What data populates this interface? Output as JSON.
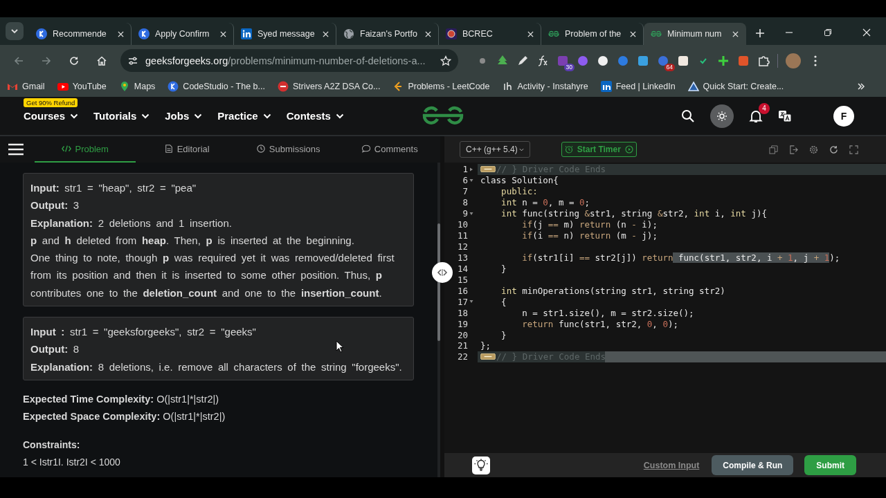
{
  "browser": {
    "tabs": [
      {
        "title": "Recommende",
        "kind": "k",
        "selected": false
      },
      {
        "title": "Apply Confirm",
        "kind": "k",
        "selected": false
      },
      {
        "title": "Syed message",
        "kind": "linkedin",
        "selected": false
      },
      {
        "title": "Faizan's Portfo",
        "kind": "globe",
        "selected": false
      },
      {
        "title": "BCREC",
        "kind": "crest",
        "selected": false
      },
      {
        "title": "Problem of the",
        "kind": "gfg",
        "selected": false
      },
      {
        "title": "Minimum num",
        "kind": "gfg",
        "selected": true
      }
    ],
    "url_host": "geeksforgeeks.org",
    "url_path": "/problems/minimum-number-of-deletions-a...",
    "extensions": [
      {
        "kind": "dot"
      },
      {
        "kind": "tree"
      },
      {
        "kind": "pen"
      },
      {
        "kind": "fx"
      },
      {
        "kind": "hat",
        "badge": "30"
      },
      {
        "kind": "gear"
      },
      {
        "kind": "ring"
      },
      {
        "kind": "swirl"
      },
      {
        "kind": "tile"
      },
      {
        "kind": "chrome",
        "badge": "64"
      },
      {
        "kind": "card"
      },
      {
        "kind": "tick"
      },
      {
        "kind": "plus"
      },
      {
        "kind": "orange"
      },
      {
        "kind": "puzzle"
      }
    ],
    "bookmarks": [
      {
        "label": "Gmail",
        "kind": "gmail"
      },
      {
        "label": "YouTube",
        "kind": "youtube"
      },
      {
        "label": "Maps",
        "kind": "maps"
      },
      {
        "label": "CodeStudio - The b...",
        "kind": "k"
      },
      {
        "label": "Strivers A2Z DSA Co...",
        "kind": "tuf"
      },
      {
        "label": "Problems - LeetCode",
        "kind": "leetcode"
      },
      {
        "label": "Activity - Instahyre",
        "kind": "ih"
      },
      {
        "label": "Feed | LinkedIn",
        "kind": "linkedin"
      },
      {
        "label": "Quick Start: Create...",
        "kind": "triangle"
      }
    ]
  },
  "site": {
    "promo": "Get 90% Refund",
    "nav": [
      "Courses",
      "Tutorials",
      "Jobs",
      "Practice",
      "Contests"
    ],
    "notifications": "4",
    "avatar": "F"
  },
  "problem_tabs": [
    {
      "label": "Problem",
      "kind": "code",
      "selected": true
    },
    {
      "label": "Editorial",
      "kind": "doc",
      "selected": false
    },
    {
      "label": "Submissions",
      "kind": "clock",
      "selected": false
    },
    {
      "label": "Comments",
      "kind": "chat",
      "selected": false
    }
  ],
  "examples": [
    [
      "**Input:** str1 = \"heap\", str2 = \"pea\"",
      "**Output:** 3",
      "**Explanation:** 2 deletions and 1 insertion.",
      "**p** and **h** deleted from **heap**. Then, **p** is inserted at the beginning.",
      "One thing to note, though **p** was required yet it was removed/deleted first from its position and then it is inserted to some other position. Thus, **p** contributes one to the **deletion_count** and one to the **insertion_count**."
    ],
    [
      "**Input :** str1 = \"geeksforgeeks\", str2 = \"geeks\"",
      "**Output:** 8",
      "**Explanation:** 8 deletions, i.e. remove all characters of the string \"forgeeks\"."
    ]
  ],
  "complexity": [
    "**Expected Time Complexity:** O(|str1|*|str2|)",
    "**Expected Space Complexity:** O(|str1|*|str2|)"
  ],
  "constraints_title": "Constraints:",
  "constraints": "1 < Istr1I. Istr2I < 1000",
  "editor": {
    "language": "C++ (g++ 5.4)",
    "timer": "Start Timer",
    "lines": [
      {
        "number": "1",
        "expanded": false,
        "folded": true,
        "active": false,
        "tokens": [
          {
            "text": "// } Driver Code Ends",
            "kind": "comment",
            "selected": false
          }
        ]
      },
      {
        "number": "6",
        "expanded": true,
        "folded": false,
        "active": false,
        "tokens": [
          {
            "text": "class Solution{",
            "kind": "plain",
            "selected": false
          }
        ]
      },
      {
        "number": "7",
        "folded": false,
        "active": false,
        "tokens": [
          {
            "text": "    public:",
            "kind": "type",
            "selected": false
          }
        ]
      },
      {
        "number": "8",
        "folded": false,
        "active": false,
        "tokens": [
          {
            "text": "    int",
            "kind": "type",
            "selected": false
          },
          {
            "text": " n = ",
            "kind": "plain",
            "selected": false
          },
          {
            "text": "0",
            "kind": "number",
            "selected": false
          },
          {
            "text": ", m = ",
            "kind": "plain",
            "selected": false
          },
          {
            "text": "0",
            "kind": "number",
            "selected": false
          },
          {
            "text": ";",
            "kind": "plain",
            "selected": false
          }
        ]
      },
      {
        "number": "9",
        "expanded": true,
        "folded": false,
        "active": false,
        "tokens": [
          {
            "text": "    int",
            "kind": "type",
            "selected": false
          },
          {
            "text": " func(string ",
            "kind": "plain",
            "selected": false
          },
          {
            "text": "&",
            "kind": "op",
            "selected": false
          },
          {
            "text": "str1, string ",
            "kind": "plain",
            "selected": false
          },
          {
            "text": "&",
            "kind": "op",
            "selected": false
          },
          {
            "text": "str2, ",
            "kind": "plain",
            "selected": false
          },
          {
            "text": "int",
            "kind": "type",
            "selected": false
          },
          {
            "text": " i, ",
            "kind": "plain",
            "selected": false
          },
          {
            "text": "int",
            "kind": "type",
            "selected": false
          },
          {
            "text": " j){",
            "kind": "plain",
            "selected": false
          }
        ]
      },
      {
        "number": "10",
        "folded": false,
        "active": false,
        "tokens": [
          {
            "text": "        if",
            "kind": "op",
            "selected": false
          },
          {
            "text": "(j ",
            "kind": "plain",
            "selected": false
          },
          {
            "text": "==",
            "kind": "op",
            "selected": false
          },
          {
            "text": " m) ",
            "kind": "plain",
            "selected": false
          },
          {
            "text": "return",
            "kind": "op",
            "selected": false
          },
          {
            "text": " (n ",
            "kind": "plain",
            "selected": false
          },
          {
            "text": "-",
            "kind": "op",
            "selected": false
          },
          {
            "text": " i);",
            "kind": "plain",
            "selected": false
          }
        ]
      },
      {
        "number": "11",
        "folded": false,
        "active": false,
        "tokens": [
          {
            "text": "        if",
            "kind": "op",
            "selected": false
          },
          {
            "text": "(i ",
            "kind": "plain",
            "selected": false
          },
          {
            "text": "==",
            "kind": "op",
            "selected": false
          },
          {
            "text": " n) ",
            "kind": "plain",
            "selected": false
          },
          {
            "text": "return",
            "kind": "op",
            "selected": false
          },
          {
            "text": " (m ",
            "kind": "plain",
            "selected": false
          },
          {
            "text": "-",
            "kind": "op",
            "selected": false
          },
          {
            "text": " j);",
            "kind": "plain",
            "selected": false
          }
        ]
      },
      {
        "number": "12",
        "folded": false,
        "active": false
      },
      {
        "number": "13",
        "folded": false,
        "active": false,
        "tokens": [
          {
            "text": "        if",
            "kind": "op",
            "selected": false
          },
          {
            "text": "(str1[i] ",
            "kind": "plain",
            "selected": false
          },
          {
            "text": "==",
            "kind": "op",
            "selected": false
          },
          {
            "text": " str2[j]) ",
            "kind": "plain",
            "selected": false
          },
          {
            "text": "return",
            "kind": "op",
            "selected": false
          },
          {
            "text": " func(str1, str2, i ",
            "kind": "plain",
            "selected": true
          },
          {
            "text": "+",
            "kind": "op",
            "selected": true
          },
          {
            "text": " 1",
            "kind": "number",
            "selected": true
          },
          {
            "text": ", j ",
            "kind": "plain",
            "selected": true
          },
          {
            "text": "+",
            "kind": "op",
            "selected": true
          },
          {
            "text": " 1",
            "kind": "number",
            "selected": true
          },
          {
            "text": ");",
            "kind": "plain",
            "selected": false
          }
        ]
      },
      {
        "number": "14",
        "folded": false,
        "active": false,
        "tokens": [
          {
            "text": "    }",
            "kind": "plain",
            "selected": false
          }
        ]
      },
      {
        "number": "15",
        "folded": false,
        "active": false
      },
      {
        "number": "16",
        "folded": false,
        "active": false,
        "tokens": [
          {
            "text": "    int",
            "kind": "type",
            "selected": false
          },
          {
            "text": " minOperations(string str1, string str2)",
            "kind": "plain",
            "selected": false
          }
        ]
      },
      {
        "number": "17",
        "expanded": true,
        "folded": false,
        "active": false,
        "tokens": [
          {
            "text": "    {",
            "kind": "plain",
            "selected": false
          }
        ]
      },
      {
        "number": "18",
        "folded": false,
        "active": false,
        "tokens": [
          {
            "text": "        n = str1.size(), m = str2.size();",
            "kind": "plain",
            "selected": false
          }
        ]
      },
      {
        "number": "19",
        "folded": false,
        "active": false,
        "tokens": [
          {
            "text": "        return",
            "kind": "op",
            "selected": false
          },
          {
            "text": " func(str1, str2, ",
            "kind": "plain",
            "selected": false
          },
          {
            "text": "0",
            "kind": "number",
            "selected": false
          },
          {
            "text": ", ",
            "kind": "plain",
            "selected": false
          },
          {
            "text": "0",
            "kind": "number",
            "selected": false
          },
          {
            "text": ");",
            "kind": "plain",
            "selected": false
          }
        ]
      },
      {
        "number": "20",
        "folded": false,
        "active": false,
        "tokens": [
          {
            "text": "    }",
            "kind": "plain",
            "selected": false
          }
        ]
      },
      {
        "number": "21",
        "folded": false,
        "active": false,
        "tokens": [
          {
            "text": "};",
            "kind": "plain",
            "selected": false
          }
        ]
      },
      {
        "number": "22",
        "folded": true,
        "active": true,
        "tokens": [
          {
            "text": "// } Driver Code Ends",
            "kind": "comment",
            "selected": false
          }
        ]
      }
    ],
    "custom_input": "Custom Input",
    "compile": "Compile & Run",
    "submit": "Submit"
  }
}
